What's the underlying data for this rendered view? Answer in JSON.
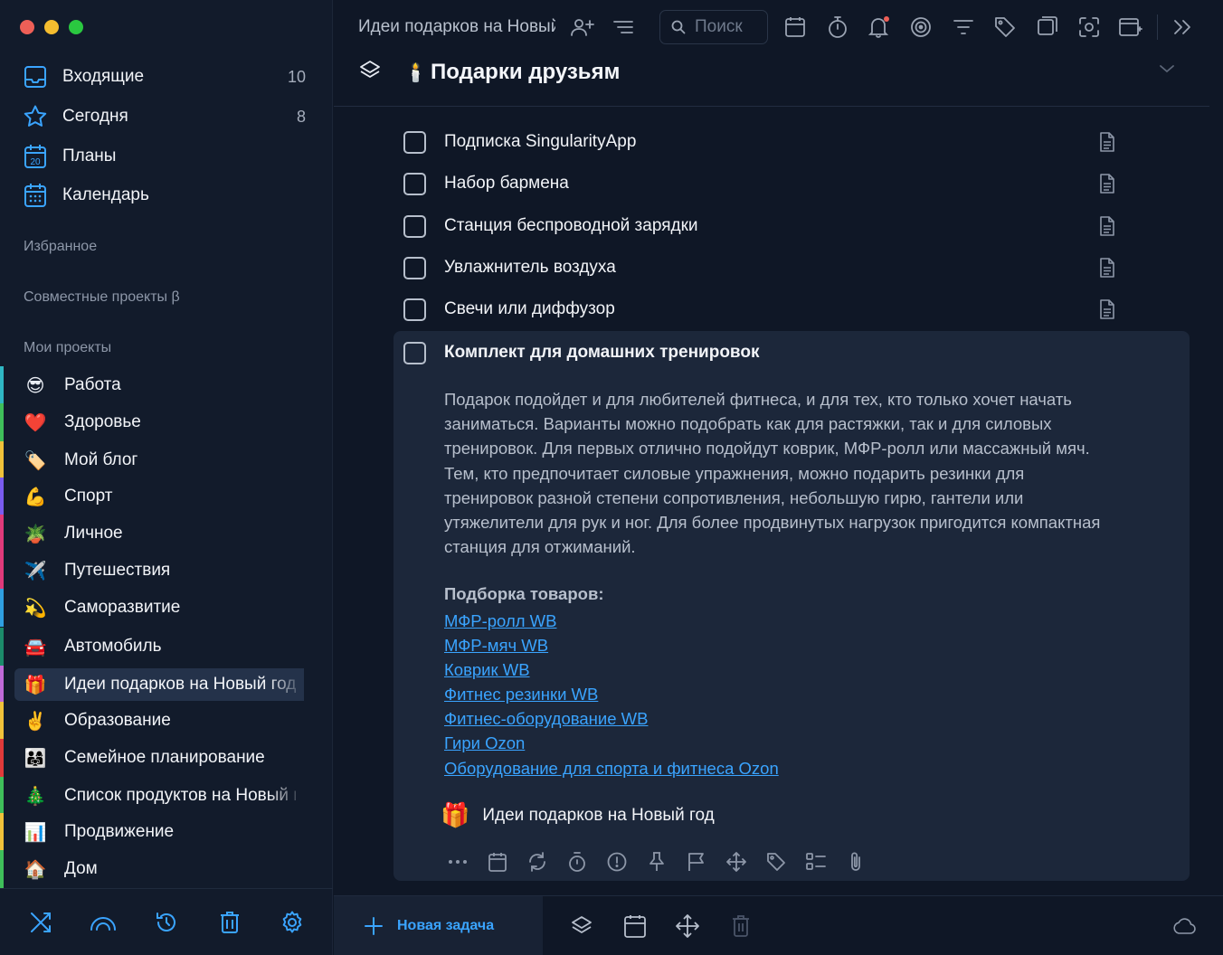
{
  "sidebar": {
    "nav": [
      {
        "label": "Входящие",
        "count": "10",
        "icon": "inbox-icon"
      },
      {
        "label": "Сегодня",
        "count": "8",
        "icon": "star-icon"
      },
      {
        "label": "Планы",
        "count": "",
        "icon": "calendar-20-icon"
      },
      {
        "label": "Календарь",
        "count": "",
        "icon": "calendar-grid-icon"
      }
    ],
    "sections": {
      "favorites": "Избранное",
      "shared": "Совместные проекты β",
      "my_projects": "Мои проекты"
    },
    "projects": [
      {
        "emoji": "😎",
        "label": "Работа",
        "color": "#2fb7c4"
      },
      {
        "emoji": "❤️",
        "label": "Здоровье",
        "color": "#3fbf5a"
      },
      {
        "emoji": "🏷️",
        "label": "Мой блог",
        "color": "#f0c23a"
      },
      {
        "emoji": "💪",
        "label": "Спорт",
        "color": "#7a5cf0"
      },
      {
        "emoji": "🪴",
        "label": "Личное",
        "color": "#e03a7a"
      },
      {
        "emoji": "✈️",
        "label": "Путешествия",
        "color": "#e03a7a"
      },
      {
        "emoji": "💫",
        "label": "Саморазвитие",
        "color": "#2f9fe0"
      },
      {
        "emoji": "🚘",
        "label": "Автомобиль",
        "color": "#1c8b6a"
      },
      {
        "emoji": "🎁",
        "label": "Идеи подарков на Новый год",
        "color": "#c06ad8"
      },
      {
        "emoji": "✌️",
        "label": "Образование",
        "color": "#f0c23a"
      },
      {
        "emoji": "👨‍👩‍👧",
        "label": "Семейное планирование",
        "color": "#e03a3a"
      },
      {
        "emoji": "🎄",
        "label": "Список продуктов на Новый год",
        "color": "#3fbf5a"
      },
      {
        "emoji": "📊",
        "label": "Продвижение",
        "color": "#f0c23a"
      },
      {
        "emoji": "🏠",
        "label": "Дом",
        "color": "#3fbf5a"
      }
    ],
    "bottom_icons": [
      "shuffle-icon",
      "rainbow-icon",
      "history-icon",
      "trash-icon",
      "settings-icon"
    ]
  },
  "topbar": {
    "breadcrumb": "Идеи подарков на Новый год",
    "search_placeholder": "Поиск"
  },
  "header": {
    "emoji": "🕯️",
    "title": "Подарки друзьям"
  },
  "tasks": [
    {
      "label": "Подписка SingularityApp"
    },
    {
      "label": "Набор бармена"
    },
    {
      "label": "Станция беспроводной зарядки"
    },
    {
      "label": "Увлажнитель воздуха"
    },
    {
      "label": "Свечи или диффузор"
    }
  ],
  "expanded_task": {
    "label": "Комплект для домашних тренировок",
    "description": [
      "Подарок подойдет и для любителей фитнеса, и для тех, кто только хочет начать",
      "заниматься. Варианты можно подобрать как для растяжки, так и для силовых",
      "тренировок. Для первых отлично подойдут коврик, МФР-ролл или массажный мяч.",
      "Тем, кто предпочитает силовые упражнения, можно подарить резинки для",
      "тренировок разной степени сопротивления, небольшую гирю, гантели или",
      "утяжелители для рук и ног. Для более продвинутых нагрузок пригодится компактная",
      "станция для отжиманий."
    ],
    "list_heading": "Подборка товаров:",
    "links": [
      "МФР-ролл WB",
      "МФР-мяч WB",
      "Коврик WB",
      "Фитнес резинки WB",
      "Фитнес-оборудование WB",
      "Гири Ozon",
      "Оборудование для спорта и фитнеса Ozon"
    ],
    "project_emoji": "🎁",
    "project_label": "Идеи подарков на Новый год"
  },
  "bottombar": {
    "new_task": "Новая задача"
  }
}
